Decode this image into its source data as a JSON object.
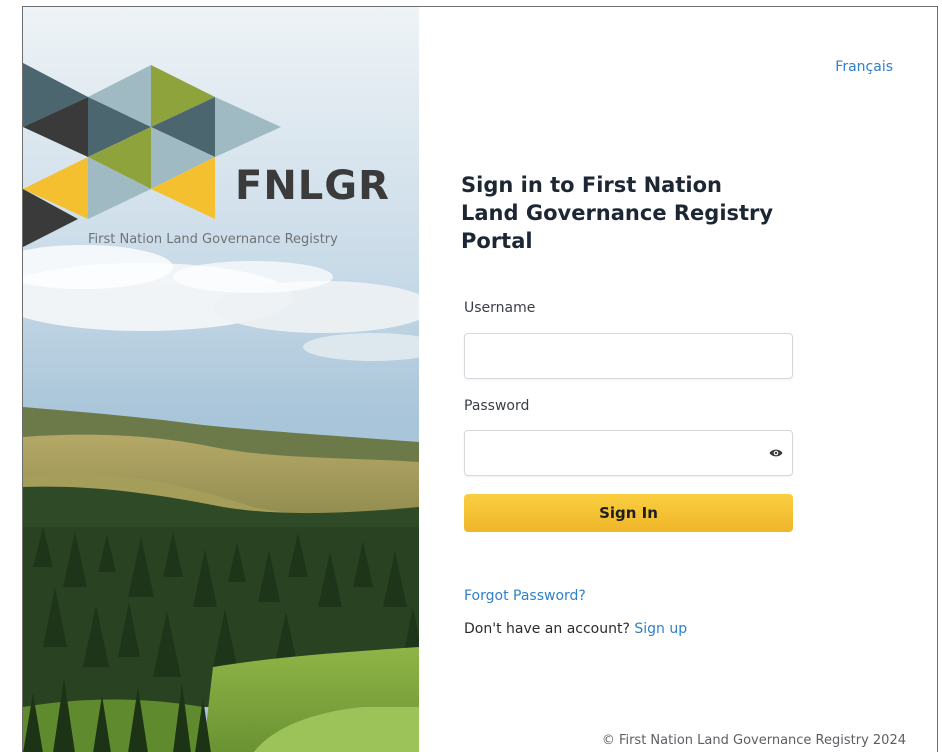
{
  "branding": {
    "logo_abbrev": "FNLGR",
    "logo_full_name": "First Nation Land Governance Registry"
  },
  "header": {
    "language_link": "Français"
  },
  "form": {
    "title_line1": "Sign in to First Nation",
    "title_line2": "Land Governance Registry",
    "title_line3": "Portal",
    "username_label": "Username",
    "username_value": "",
    "password_label": "Password",
    "password_value": "",
    "submit_label": "Sign In"
  },
  "links": {
    "forgot_password": "Forgot Password?",
    "no_account_text": "Don't have an account?",
    "sign_up": "Sign up"
  },
  "footer": {
    "copyright": "© First Nation Land Governance Registry 2024"
  },
  "icons": {
    "password_toggle": "eye-icon"
  },
  "colors": {
    "accent_yellow": "#f4c02f",
    "link_blue": "#2f80c9",
    "logo_olive": "#8fa33c",
    "logo_slate": "#4c6670",
    "logo_dark": "#3a3a3a",
    "logo_light_blue": "#9fbac2"
  }
}
